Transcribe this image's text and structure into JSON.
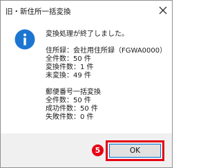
{
  "dialog": {
    "title": "旧・新住所一括変換",
    "icon": "info-icon",
    "message": {
      "headline": "変換処理が終了しました。",
      "address_line": "住所録：会社用住所録（FGWA0000）",
      "address_total": "全件数：50 件",
      "address_converted": "変換件数：1 件",
      "address_unconverted": "未変換：49 件",
      "postal_title": "郵便番号一括変換",
      "postal_total": "全件数：50 件",
      "postal_success": "成功件数：50 件",
      "postal_failed": "失敗件数：0 件"
    }
  },
  "buttons": {
    "ok_label": "OK"
  },
  "annotation": {
    "step_number": "5",
    "color": "#e60012"
  },
  "colors": {
    "info_blue": "#1c75d1",
    "button_focus": "#0078d7",
    "footer_bg": "#f0f0f0"
  }
}
